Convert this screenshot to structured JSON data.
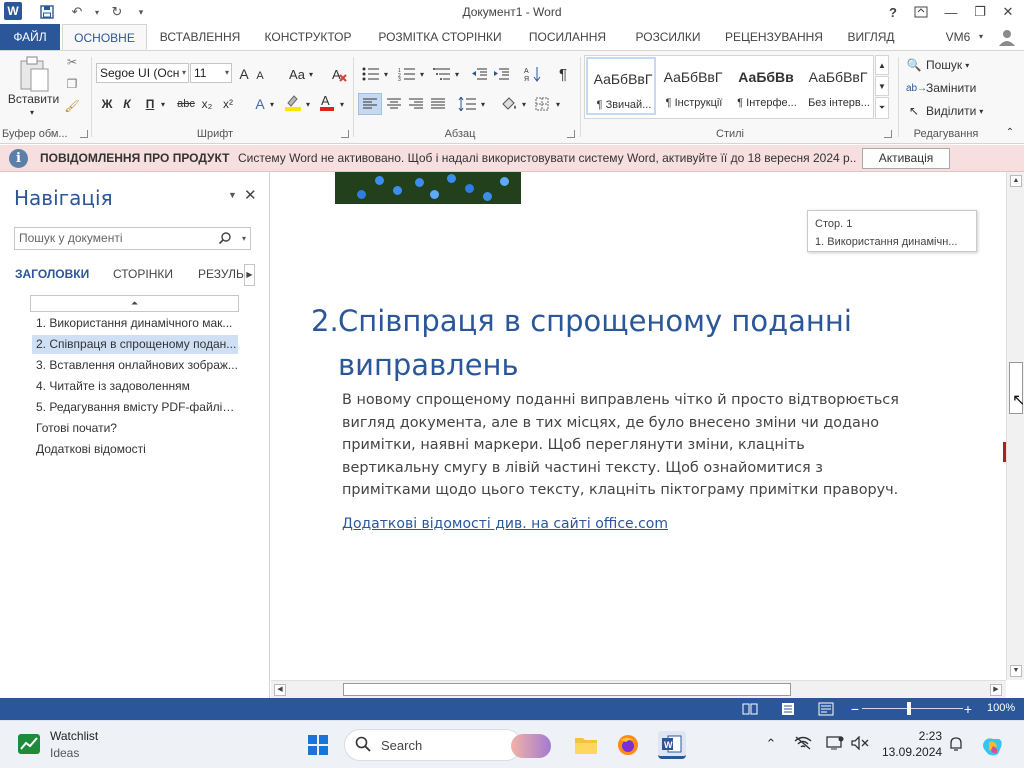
{
  "titlebar": {
    "title": "Документ1 - Word",
    "help": "?"
  },
  "tabs": [
    "ФАЙЛ",
    "ОСНОВНЕ",
    "ВСТАВЛЕННЯ",
    "КОНСТРУКТОР",
    "РОЗМІТКА СТОРІНКИ",
    "ПОСИЛАННЯ",
    "РОЗСИЛКИ",
    "РЕЦЕНЗУВАННЯ",
    "ВИГЛЯД"
  ],
  "user": "VM6",
  "ribbon": {
    "clipboard": {
      "paste_label": "Вставити",
      "group_label": "Буфер обм..."
    },
    "font": {
      "font_name": "Segoe UI (Осн",
      "font_size": "11",
      "group_label": "Шрифт",
      "bold": "Ж",
      "italic": "К",
      "underline": "П",
      "strike": "abc",
      "subscript": "x₂",
      "superscript": "x²",
      "grow": "A",
      "shrink": "A",
      "case": "Aa"
    },
    "paragraph": {
      "group_label": "Абзац",
      "pilcrow": "¶"
    },
    "styles": {
      "group_label": "Стилі",
      "items": [
        {
          "sample": "АаБбВвГ",
          "name": "¶ Звичай..."
        },
        {
          "sample": "АаБбВвГ",
          "name": "¶ Інструкції"
        },
        {
          "sample": "АаБбВв",
          "name": "¶ Інтерфе..."
        },
        {
          "sample": "АаБбВвГ",
          "name": "Без інтерв..."
        }
      ]
    },
    "editing": {
      "group_label": "Редагування",
      "find": "Пошук",
      "replace": "Замінити",
      "select": "Виділити"
    }
  },
  "notification": {
    "title": "ПОВІДОМЛЕННЯ ПРО ПРОДУКТ",
    "text": "Систему Word не активовано. Щоб і надалі використовувати систему Word, активуйте її до 18 вересня 2024 р..",
    "button": "Активація"
  },
  "navigation": {
    "title": "Навігація",
    "search_placeholder": "Пошук у документі",
    "tabs": [
      "ЗАГОЛОВКИ",
      "СТОРІНКИ",
      "РЕЗУЛЬ"
    ],
    "headings": [
      "1. Використання динамічного мак...",
      "2. Співпраця в спрощеному подан...",
      "3. Вставлення онлайнових зображ...",
      "4. Читайте із задоволенням",
      "5. Редагування вмісту PDF-файлів...",
      "Готові почати?",
      "Додаткові відомості"
    ],
    "selected_index": 1
  },
  "document": {
    "tooltip_page": "Стор. 1",
    "tooltip_heading": "1. Використання динамічн...",
    "heading_number": "2.",
    "heading_text": "Співпраця в спрощеному поданні виправлень",
    "body": "В новому спрощеному поданні виправлень чітко й просто відтворюється вигляд документа, але в тих місцях, де було внесено зміни чи додано примітки, наявні маркери. Щоб переглянути зміни, клацніть вертикальну смугу в лівій частині тексту. Щоб ознайомитися з примітками щодо цього тексту, клацніть піктограму примітки праворуч.",
    "link": "Додаткові відомості див. на сайті office.com"
  },
  "statusbar": {
    "zoom": "100%",
    "zoom_fraction": 0.5
  },
  "taskbar": {
    "widget_title": "Watchlist",
    "widget_subtitle": "Ideas",
    "search": "Search",
    "time": "2:23",
    "date": "13.09.2024"
  },
  "colors": {
    "accent": "#2b579a",
    "notification_bg": "#f8dfdf",
    "selection": "#cfe0f5"
  }
}
